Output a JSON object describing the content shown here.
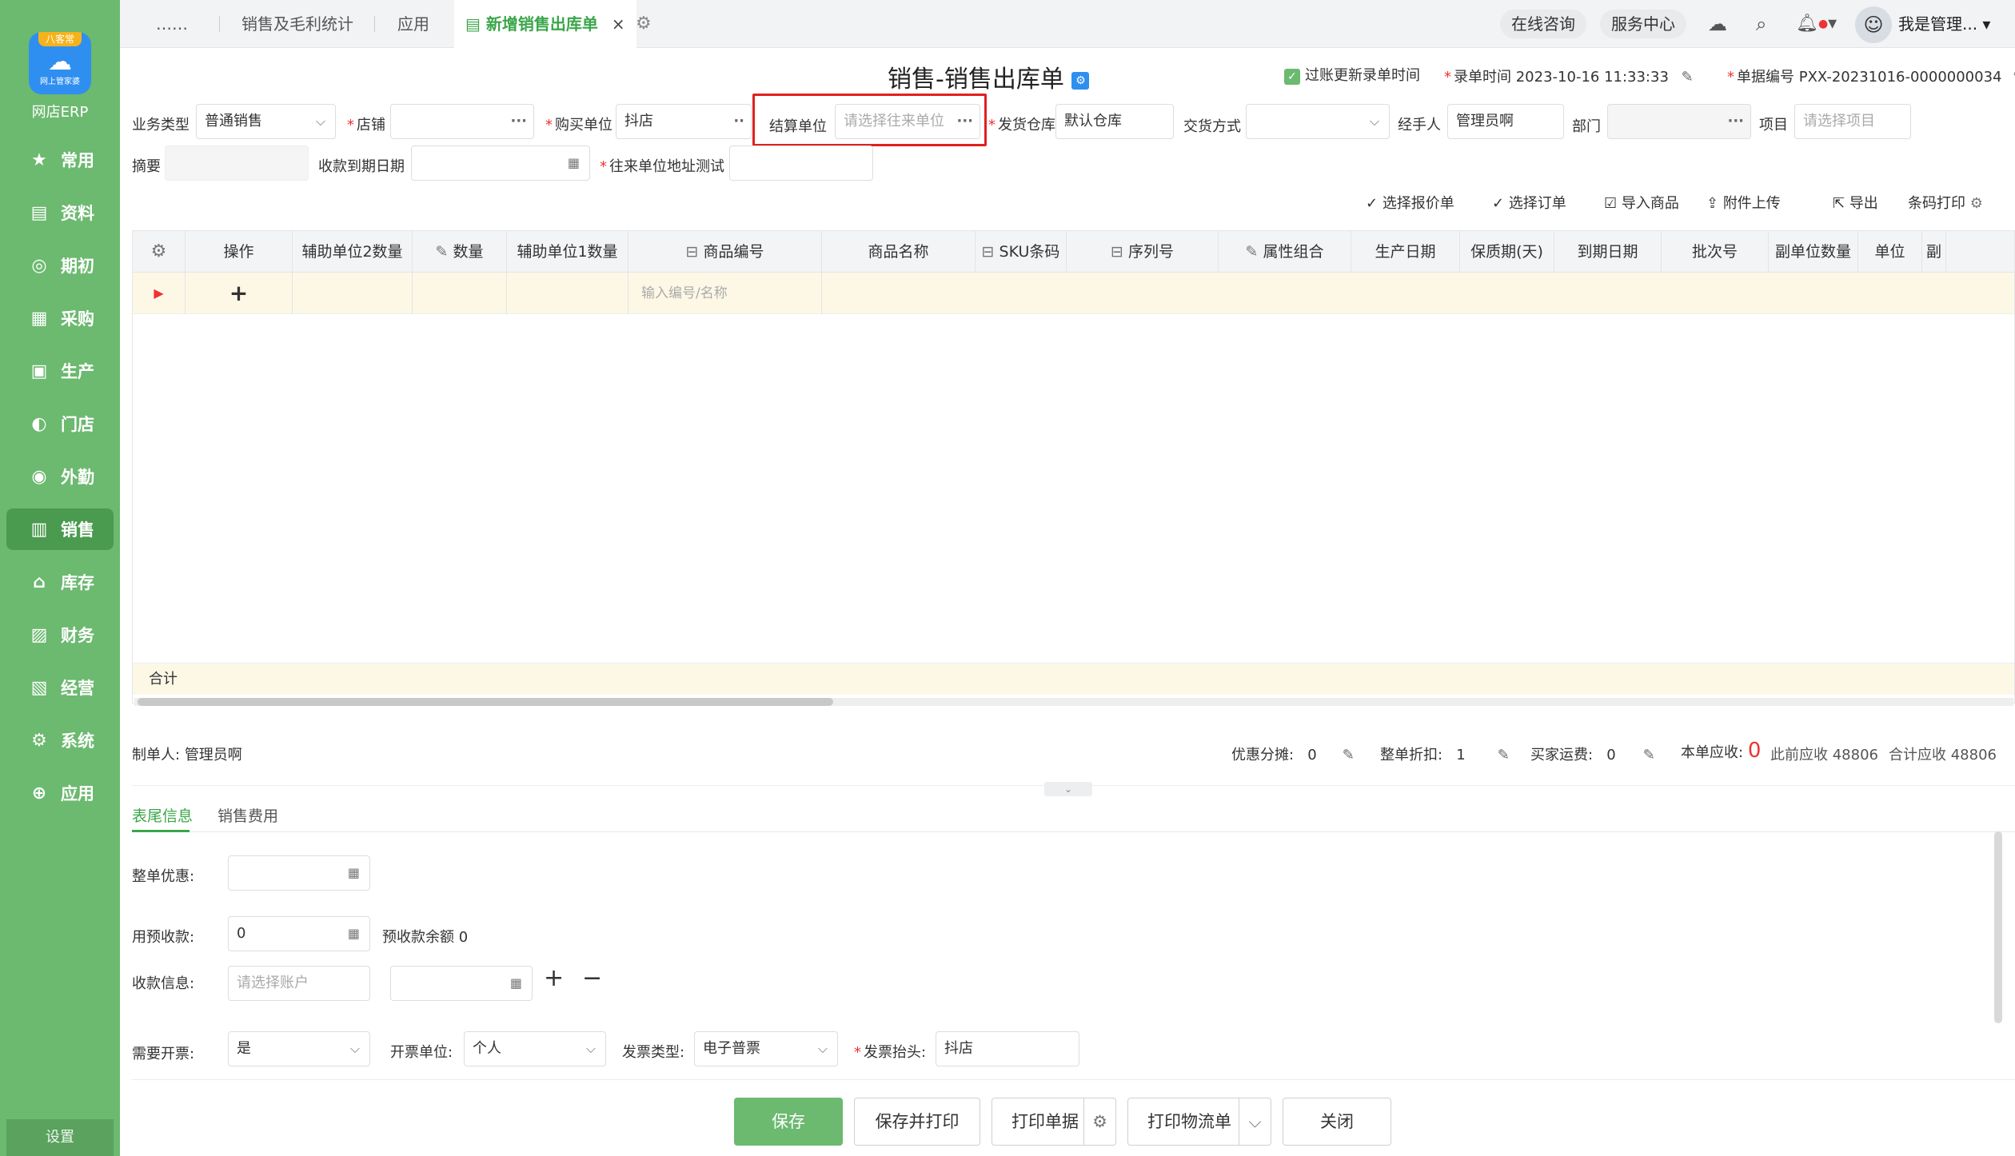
{
  "sidebar": {
    "logo_top": "八客常",
    "logo_sub": "网上管家婆",
    "brand": "网店ERP",
    "items": [
      {
        "label": "常用",
        "icon": "star-icon",
        "glyph": "★"
      },
      {
        "label": "资料",
        "icon": "document-icon",
        "glyph": "▤"
      },
      {
        "label": "期初",
        "icon": "target-icon",
        "glyph": "◎"
      },
      {
        "label": "采购",
        "icon": "purchase-icon",
        "glyph": "▦"
      },
      {
        "label": "生产",
        "icon": "production-icon",
        "glyph": "▣"
      },
      {
        "label": "门店",
        "icon": "store-icon",
        "glyph": "◐"
      },
      {
        "label": "外勤",
        "icon": "fieldwork-icon",
        "glyph": "◉"
      },
      {
        "label": "销售",
        "icon": "sales-icon",
        "glyph": "▥"
      },
      {
        "label": "库存",
        "icon": "warehouse-icon",
        "glyph": "⌂"
      },
      {
        "label": "财务",
        "icon": "wallet-icon",
        "glyph": "▨"
      },
      {
        "label": "经营",
        "icon": "chart-icon",
        "glyph": "▧"
      },
      {
        "label": "系统",
        "icon": "gear-icon",
        "glyph": "⚙"
      },
      {
        "label": "应用",
        "icon": "plus-icon",
        "glyph": "⊕"
      }
    ],
    "settings": "设置"
  },
  "tabs": {
    "more": "……",
    "t1": "销售及毛利统计",
    "t2": "应用",
    "active": "新增销售出库单",
    "close": "×"
  },
  "top_right": {
    "consult": "在线咨询",
    "service": "服务中心",
    "user": "我是管理..."
  },
  "title": "销售-销售出库单",
  "header_meta": {
    "update_time_label": "过账更新录单时间",
    "entry_time_label": "录单时间",
    "entry_time": "2023-10-16 11:33:33",
    "bill_no_label": "单据编号",
    "bill_no": "PXX-20231016-0000000034"
  },
  "form": {
    "biz_type_label": "业务类型",
    "biz_type": "普通销售",
    "shop_label": "店铺",
    "shop": "",
    "buyer_label": "购买单位",
    "buyer": "抖店",
    "settle_label": "结算单位",
    "settle_placeholder": "请选择往来单位",
    "warehouse_label": "发货仓库",
    "warehouse": "默认仓库",
    "delivery_label": "交货方式",
    "delivery": "",
    "handler_label": "经手人",
    "handler": "管理员啊",
    "dept_label": "部门",
    "dept": "",
    "project_label": "项目",
    "project_placeholder": "请选择项目",
    "summary_label": "摘要",
    "due_date_label": "收款到期日期",
    "address_label": "往来单位地址测试"
  },
  "toolbar": {
    "quote": "选择报价单",
    "order": "选择订单",
    "import": "导入商品",
    "attach": "附件上传",
    "export": "导出",
    "barcode": "条码打印"
  },
  "grid": {
    "columns": [
      "操作",
      "辅助单位2数量",
      "数量",
      "辅助单位1数量",
      "商品编号",
      "商品名称",
      "SKU条码",
      "序列号",
      "属性组合",
      "生产日期",
      "保质期(天)",
      "到期日期",
      "批次号",
      "副单位数量",
      "单位",
      "副"
    ],
    "input_placeholder": "输入编号/名称",
    "total_label": "合计"
  },
  "summary": {
    "maker_label": "制单人:",
    "maker": "管理员啊",
    "discount_share_label": "优惠分摊:",
    "discount_share": "0",
    "whole_discount_label": "整单折扣:",
    "whole_discount": "1",
    "freight_label": "买家运费:",
    "freight": "0",
    "receivable_label": "本单应收:",
    "receivable": "0",
    "prev_receivable": "此前应收 48806",
    "total_receivable": "合计应收 48806"
  },
  "subtabs": {
    "tail": "表尾信息",
    "fee": "销售费用"
  },
  "tail": {
    "whole_off_label": "整单优惠:",
    "prepay_label": "用预收款:",
    "prepay": "0",
    "prepay_balance": "预收款余额 0",
    "receipt_label": "收款信息:",
    "account_placeholder": "请选择账户",
    "invoice_need_label": "需要开票:",
    "invoice_need": "是",
    "invoice_unit_label": "开票单位:",
    "invoice_unit": "个人",
    "invoice_type_label": "发票类型:",
    "invoice_type": "电子普票",
    "invoice_title_label": "发票抬头:",
    "invoice_title": "抖店"
  },
  "footer": {
    "save": "保存",
    "save_print": "保存并打印",
    "print_bill": "打印单据",
    "print_logistics": "打印物流单",
    "close": "关闭"
  },
  "colors": {
    "sidebar": "#6cb970",
    "accent": "#3aa64a",
    "highlight": "#e02020"
  }
}
